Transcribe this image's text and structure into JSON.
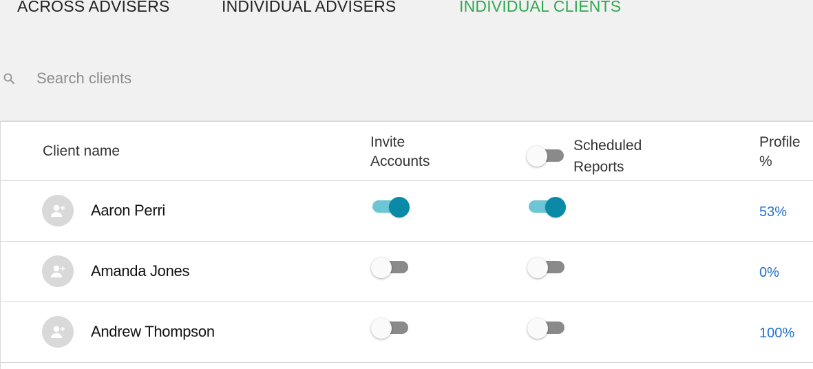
{
  "tabs": [
    {
      "label": "ACROSS ADVISERS",
      "active": false
    },
    {
      "label": "INDIVIDUAL ADVISERS",
      "active": false
    },
    {
      "label": "INDIVIDUAL CLIENTS",
      "active": true
    }
  ],
  "search": {
    "placeholder": "Search clients",
    "value": "",
    "icon": "search-icon"
  },
  "table": {
    "headers": {
      "client_name": "Client name",
      "invite_line1": "Invite",
      "invite_line2": "Accounts",
      "scheduled_line1": "Scheduled",
      "scheduled_line2": "Reports",
      "profile_line1": "Profile",
      "profile_line2": "%"
    },
    "scheduled_all_toggle": false,
    "rows": [
      {
        "name": "Aaron Perri",
        "invite": true,
        "scheduled": true,
        "profile": "53%"
      },
      {
        "name": "Amanda Jones",
        "invite": false,
        "scheduled": false,
        "profile": "0%"
      },
      {
        "name": "Andrew Thompson",
        "invite": false,
        "scheduled": false,
        "profile": "100%"
      }
    ]
  },
  "colors": {
    "active_tab": "#2fa84f",
    "toggle_on_thumb": "#0b8aa8",
    "toggle_on_track": "#6cc6d4",
    "toggle_off_track": "#8a8a8a",
    "link": "#1f6fd0"
  }
}
